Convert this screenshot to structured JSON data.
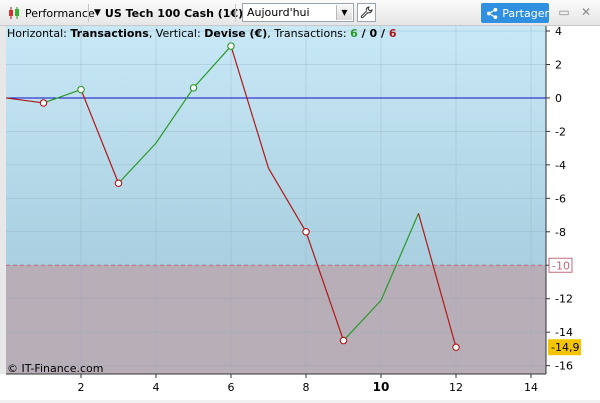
{
  "toolbar": {
    "perf_label": "Performance",
    "instrument": "US Tech 100 Cash (1€)",
    "date_value": "Aujourd'hui",
    "share_label": "Partager",
    "icons": [
      "candlestick-icon",
      "chevron-down-icon",
      "wrench-icon",
      "share-icon",
      "minimize-icon",
      "close-icon"
    ]
  },
  "header": {
    "h_label": "Horizontal: ",
    "h_value": "Transactions",
    "v_label": ", Vertical: ",
    "v_value": "Devise (€)",
    "t_label": ", Transactions: ",
    "t_win": "6",
    "t_sep1": " / ",
    "t_zero": "0",
    "t_sep2": " / ",
    "t_loss": "6"
  },
  "copyright": "© IT-Finance.com",
  "colors": {
    "win": "#2a9a2a",
    "loss": "#b01818",
    "zero_line": "#1010c8",
    "last_badge": "#f5c400",
    "upper_bg": "#bfe3f3",
    "lower_bg": "#b8aeb8"
  },
  "chart_data": {
    "type": "line",
    "x": [
      0,
      1,
      2,
      3,
      4,
      5,
      6,
      7,
      8,
      9,
      10,
      11,
      12
    ],
    "y": [
      0,
      -0.3,
      0.5,
      -5.1,
      -2.7,
      0.6,
      3.1,
      -4.2,
      -8,
      -14.5,
      -12.1,
      -6.9,
      -14.9
    ],
    "markers_x": [
      1,
      2,
      3,
      5,
      6,
      8,
      9,
      12
    ],
    "xlim": [
      0,
      14.4
    ],
    "ylim": [
      -16.5,
      4.3
    ],
    "xticks": [
      2,
      4,
      6,
      8,
      10,
      12,
      14
    ],
    "xtick_labels": [
      "2",
      "4",
      "6",
      "8",
      "10",
      "12",
      "14"
    ],
    "yticks": [
      4,
      2,
      0,
      -2,
      -4,
      -6,
      -8,
      -10,
      -12,
      -14,
      -16
    ],
    "ytick_labels": [
      "4",
      "2",
      "0",
      "-2",
      "-4",
      "-6",
      "-8",
      "-10",
      "-12",
      "-14",
      "-16"
    ],
    "threshold": -10,
    "threshold_label": "-10",
    "last_value_label": "-14,9",
    "grid": true
  }
}
